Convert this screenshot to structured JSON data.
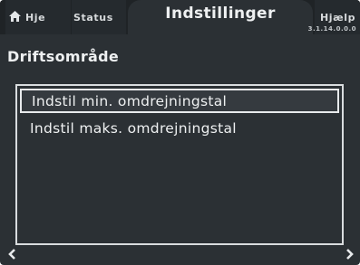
{
  "tabs": {
    "home": {
      "label": "Hje",
      "icon": "home-icon"
    },
    "status": {
      "label": "Status"
    },
    "settings": {
      "label": "Indstillinger"
    },
    "help": {
      "label": "Hjælp"
    }
  },
  "version": "3.1.14.0.0.0",
  "section": {
    "title": "Driftsområde"
  },
  "menu": {
    "items": [
      {
        "label": "Indstil min. omdrejningstal",
        "selected": true
      },
      {
        "label": "Indstil maks. omdrejningstal",
        "selected": false
      }
    ]
  },
  "nav": {
    "prev_icon": "chevron-left-icon",
    "next_icon": "chevron-right-icon"
  },
  "colors": {
    "background": "#2b3034",
    "tabbar": "#1f2326",
    "text": "#eef0f1",
    "border": "#d9dcde"
  }
}
